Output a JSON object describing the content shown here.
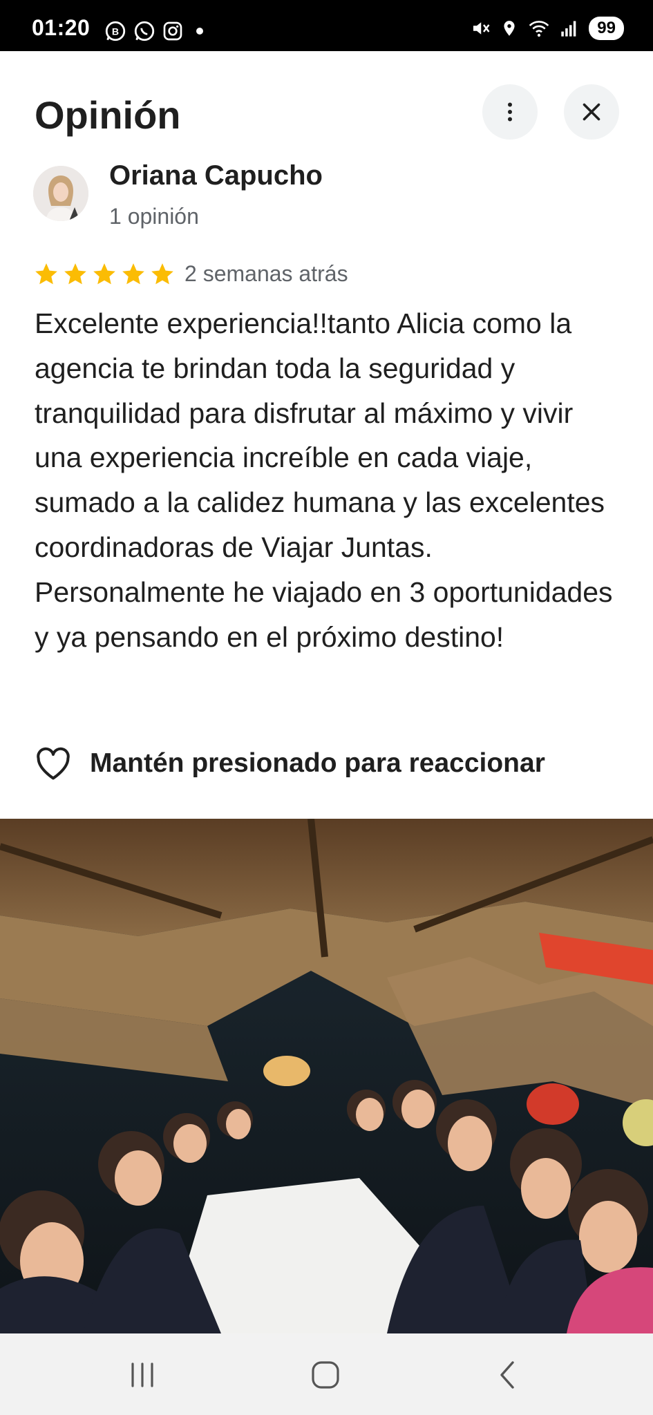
{
  "status_bar": {
    "time": "01:20",
    "battery": "99",
    "icons_left": [
      "whatsapp-business-icon",
      "whatsapp-icon",
      "instagram-icon",
      "dot-icon"
    ],
    "icons_right": [
      "mute-icon",
      "location-icon",
      "wifi-icon",
      "signal-icon"
    ]
  },
  "header": {
    "title": "Opinión",
    "more_icon": "more-vert-icon",
    "close_icon": "close-icon"
  },
  "reviewer": {
    "name": "Oriana Capucho",
    "subtitle": "1 opinión"
  },
  "review": {
    "rating": 5,
    "max_rating": 5,
    "date": "2 semanas atrás",
    "text": "Excelente experiencia!!tanto Alicia como la agencia te brindan toda la seguridad y tranquilidad para disfrutar al máximo y vivir una experiencia increíble en cada viaje, sumado a la calidez humana y las excelentes coordinadoras de Viajar Juntas. Personalmente he viajado en 3 oportunidades y ya pensando en el próximo destino!",
    "react_label": "Mantén presionado para reaccionar"
  },
  "colors": {
    "star": "#fbbc04",
    "text_primary": "#1f1f1f",
    "text_secondary": "#5f6368",
    "button_bg": "#f1f3f4"
  }
}
